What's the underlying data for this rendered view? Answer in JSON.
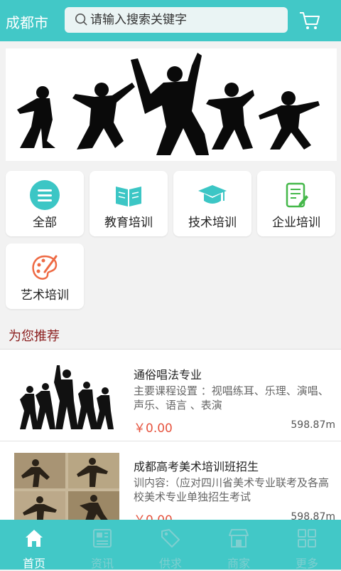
{
  "header": {
    "city": "成都市",
    "search_placeholder": "请输入搜索关键字"
  },
  "categories": [
    {
      "label": "全部",
      "icon": "menu-icon"
    },
    {
      "label": "教育培训",
      "icon": "book-icon"
    },
    {
      "label": "技术培训",
      "icon": "graduation-cap-icon"
    },
    {
      "label": "企业培训",
      "icon": "notepad-icon"
    },
    {
      "label": "艺术培训",
      "icon": "palette-icon"
    }
  ],
  "recommend": {
    "title": "为您推荐",
    "items": [
      {
        "title": "通俗唱法专业",
        "desc": "主要课程设置 ：视唱练耳、乐理、演唱、声乐、语言 、表演",
        "price": "￥0.00",
        "distance": "598.87m"
      },
      {
        "title": "成都高考美术培训班招生",
        "desc": "训内容:（应对四川省美术专业联考及各高校美术专业单独招生考试",
        "price": "￥0.00",
        "distance": "598.87m"
      }
    ]
  },
  "tabs": [
    {
      "label": "首页",
      "icon": "home-icon",
      "active": true
    },
    {
      "label": "资讯",
      "icon": "news-icon"
    },
    {
      "label": "供求",
      "icon": "tag-icon"
    },
    {
      "label": "商家",
      "icon": "store-icon"
    },
    {
      "label": "更多",
      "icon": "grid-icon"
    }
  ],
  "colors": {
    "accent": "#42c8c7",
    "price": "#e6543f",
    "section_title": "#8b1e1e"
  }
}
